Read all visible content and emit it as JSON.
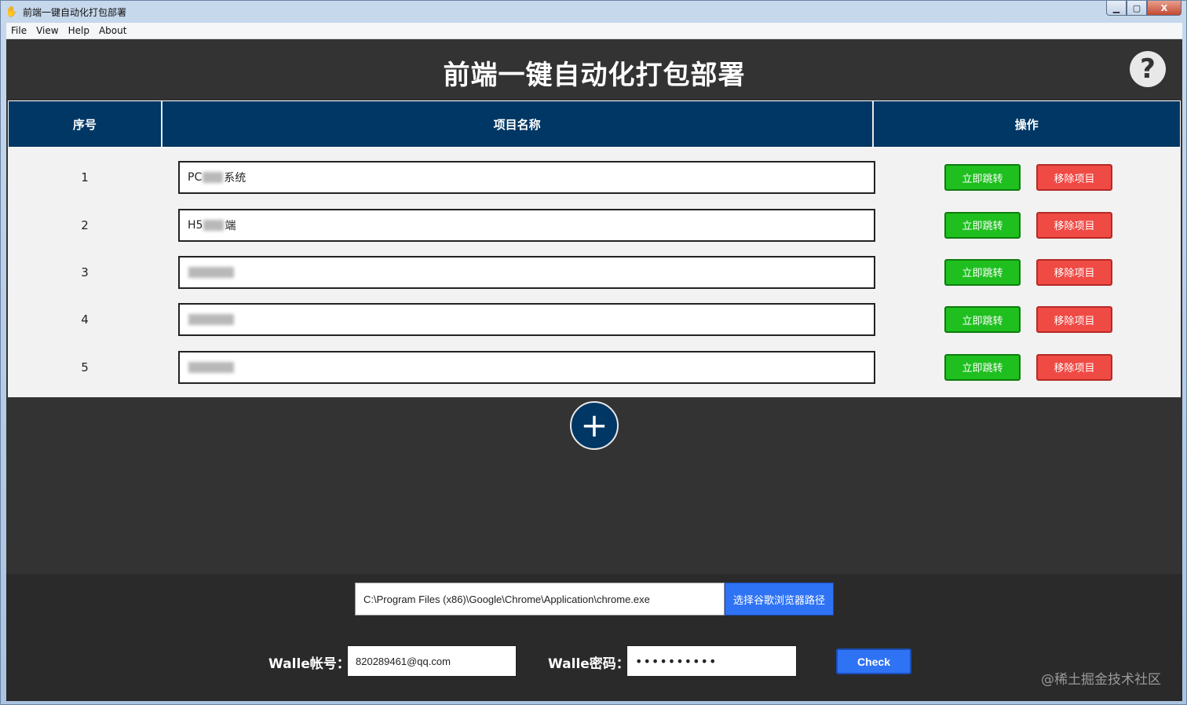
{
  "window": {
    "title": "前端一键自动化打包部署",
    "controls": [
      "▁",
      "▢",
      "X"
    ]
  },
  "menu": [
    "File",
    "View",
    "Help",
    "About"
  ],
  "app": {
    "title": "前端一键自动化打包部署",
    "help_symbol": "?"
  },
  "table": {
    "headers": [
      "序号",
      "项目名称",
      "操作"
    ],
    "rows": [
      {
        "index": "1",
        "name_prefix": "PC",
        "name_suffix": "系统"
      },
      {
        "index": "2",
        "name_prefix": "H5",
        "name_suffix": "端"
      },
      {
        "index": "3",
        "name_prefix": "",
        "name_suffix": ""
      },
      {
        "index": "4",
        "name_prefix": "",
        "name_suffix": ""
      },
      {
        "index": "5",
        "name_prefix": "",
        "name_suffix": ""
      }
    ],
    "go_label": "立即跳转",
    "remove_label": "移除项目"
  },
  "add_symbol": "+",
  "browser": {
    "path": "C:\\Program Files (x86)\\Google\\Chrome\\Application\\chrome.exe",
    "button_label": "选择谷歌浏览器路径"
  },
  "walle": {
    "account_label": "Walle帐号：",
    "account_value": "820289461@qq.com",
    "password_label": "Walle密码：",
    "password_mask": "••••••••••",
    "check_label": "Check"
  },
  "watermark": "@稀土掘金技术社区"
}
